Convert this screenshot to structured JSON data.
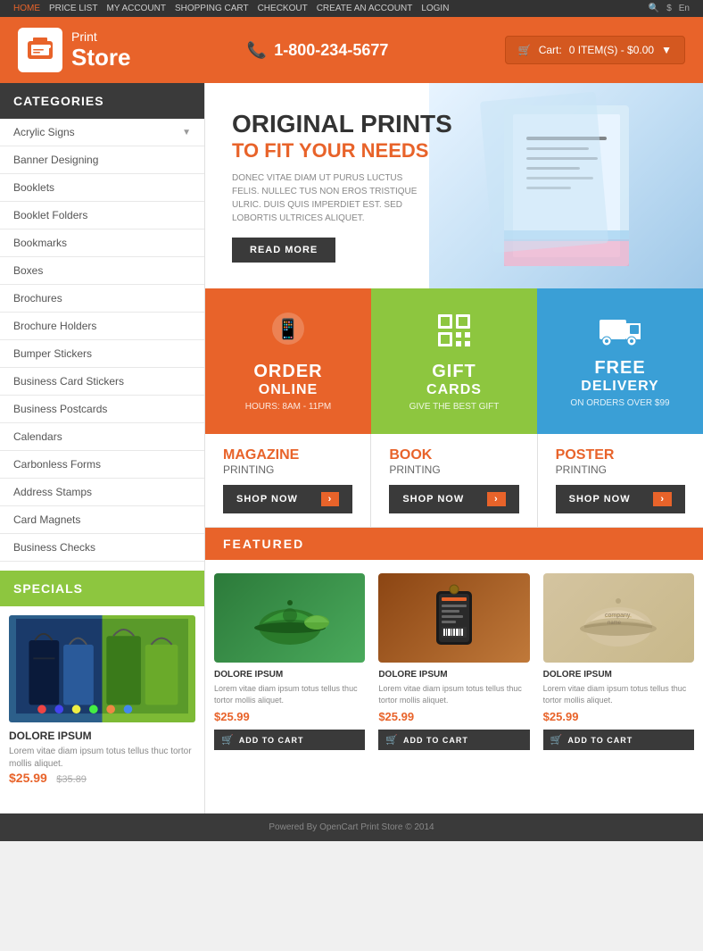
{
  "topbar": {
    "nav": [
      "HOME",
      "PRICE LIST",
      "MY ACCOUNT",
      "SHOPPING CART",
      "CHECKOUT",
      "CREATE AN ACCOUNT",
      "LOGIN"
    ],
    "right": [
      "🔍",
      "$",
      "En"
    ]
  },
  "header": {
    "logo_print": "Print",
    "logo_store": "Store",
    "phone": "1-800-234-5677",
    "cart_label": "Cart:",
    "cart_items": "0 ITEM(S) - $0.00"
  },
  "sidebar": {
    "categories_label": "CATEGORIES",
    "items": [
      {
        "label": "Acrylic Signs",
        "has_arrow": true
      },
      {
        "label": "Banner Designing",
        "has_arrow": false
      },
      {
        "label": "Booklets",
        "has_arrow": false
      },
      {
        "label": "Booklet Folders",
        "has_arrow": false
      },
      {
        "label": "Bookmarks",
        "has_arrow": false
      },
      {
        "label": "Boxes",
        "has_arrow": false
      },
      {
        "label": "Brochures",
        "has_arrow": false
      },
      {
        "label": "Brochure Holders",
        "has_arrow": false
      },
      {
        "label": "Bumper Stickers",
        "has_arrow": false
      },
      {
        "label": "Business Card Stickers",
        "has_arrow": false
      },
      {
        "label": "Business Postcards",
        "has_arrow": false
      },
      {
        "label": "Calendars",
        "has_arrow": false
      },
      {
        "label": "Carbonless Forms",
        "has_arrow": false
      },
      {
        "label": "Address Stamps",
        "has_arrow": false
      },
      {
        "label": "Card Magnets",
        "has_arrow": false
      },
      {
        "label": "Business Checks",
        "has_arrow": false
      }
    ],
    "specials_label": "SPECIALS",
    "specials_product": {
      "title": "DOLORE IPSUM",
      "desc": "Lorem vitae diam ipsum totus tellus thuc tortor mollis aliquet.",
      "price": "$25.99",
      "old_price": "$35.89"
    }
  },
  "hero": {
    "title": "ORIGINAL PRINTS",
    "subtitle": "TO FIT YOUR NEEDS",
    "desc": "DONEC VITAE DIAM UT PURUS LUCTUS FELIS. NULLEC TUS NON EROS TRISTIQUE ULRIC. DUIS QUIS IMPERDIET EST. SED LOBORTIS ULTRICES ALIQUET.",
    "button_label": "READ MORE"
  },
  "features": [
    {
      "title": "ORDER",
      "subtitle": "ONLINE",
      "desc": "HOURS: 8AM - 11PM",
      "icon": "phone",
      "color": "orange"
    },
    {
      "title": "GIFT",
      "subtitle": "CARDS",
      "desc": "GIVE THE BEST GIFT",
      "icon": "qr",
      "color": "green"
    },
    {
      "title": "FREE",
      "subtitle": "DELIVERY",
      "desc": "ON ORDERS OVER $99",
      "icon": "truck",
      "color": "blue"
    }
  ],
  "print_categories": [
    {
      "title": "MAGAZINE",
      "subtitle": "PRINTING",
      "shop_label": "SHOP NOW",
      "color": "orange"
    },
    {
      "title": "BOOK",
      "subtitle": "PRINTING",
      "shop_label": "SHOP NOW",
      "color": "orange"
    },
    {
      "title": "POSTER",
      "subtitle": "PRINTING",
      "shop_label": "SHOP NOW",
      "color": "orange"
    }
  ],
  "featured": {
    "header": "FEATURED",
    "items": [
      {
        "title": "DOLORE IPSUM",
        "desc": "Lorem vitae diam ipsum totus tellus thuc tortor mollis aliquet.",
        "price": "$25.99",
        "add_cart": "ADD TO CART"
      },
      {
        "title": "DOLORE IPSUM",
        "desc": "Lorem vitae diam ipsum totus tellus thuc tortor mollis aliquet.",
        "price": "$25.99",
        "add_cart": "ADD TO CART"
      },
      {
        "title": "DOLORE IPSUM",
        "desc": "Lorem vitae diam ipsum totus tellus thuc tortor mollis aliquet.",
        "price": "$25.99",
        "add_cart": "ADD TO CART"
      }
    ]
  },
  "footer": {
    "text": "Powered By OpenCart Print Store © 2014"
  },
  "colors": {
    "orange": "#e8632a",
    "green": "#8dc63f",
    "blue": "#3a9fd6",
    "dark": "#3a3a3a"
  }
}
